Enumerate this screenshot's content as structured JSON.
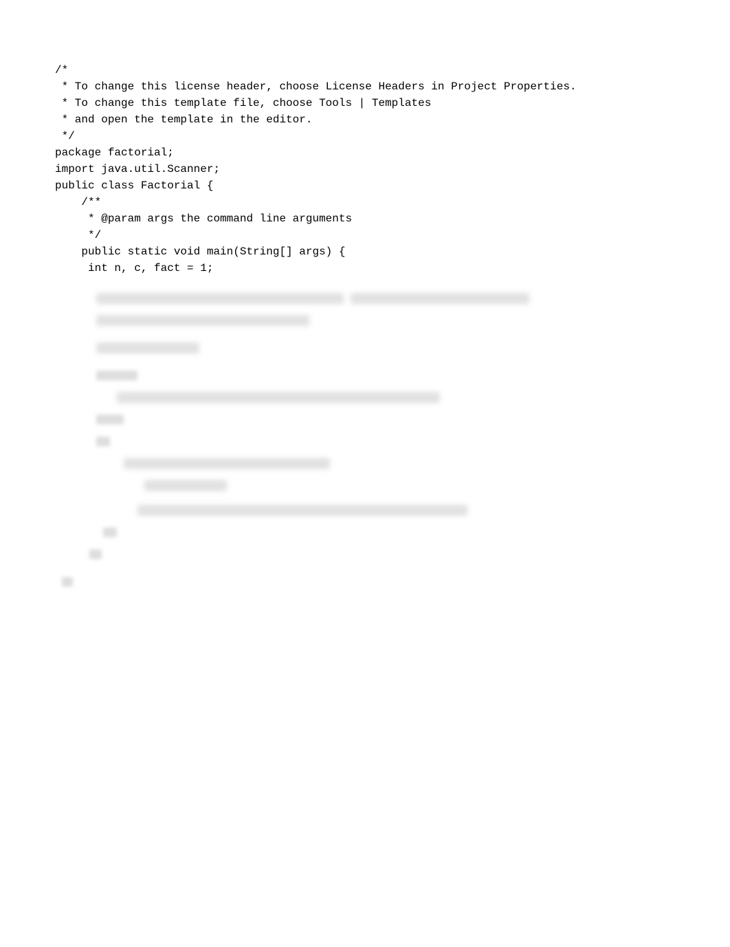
{
  "code_lines": [
    "/*",
    " * To change this license header, choose License Headers in Project Properties.",
    " * To change this template file, choose Tools | Templates",
    " * and open the template in the editor.",
    " */",
    "package factorial;",
    "",
    "import java.util.Scanner;",
    "",
    "public class Factorial {",
    "",
    "    /**",
    "     * @param args the command line arguments",
    "     */",
    "    public static void main(String[] args) {",
    "     int n, c, fact = 1;",
    ""
  ]
}
